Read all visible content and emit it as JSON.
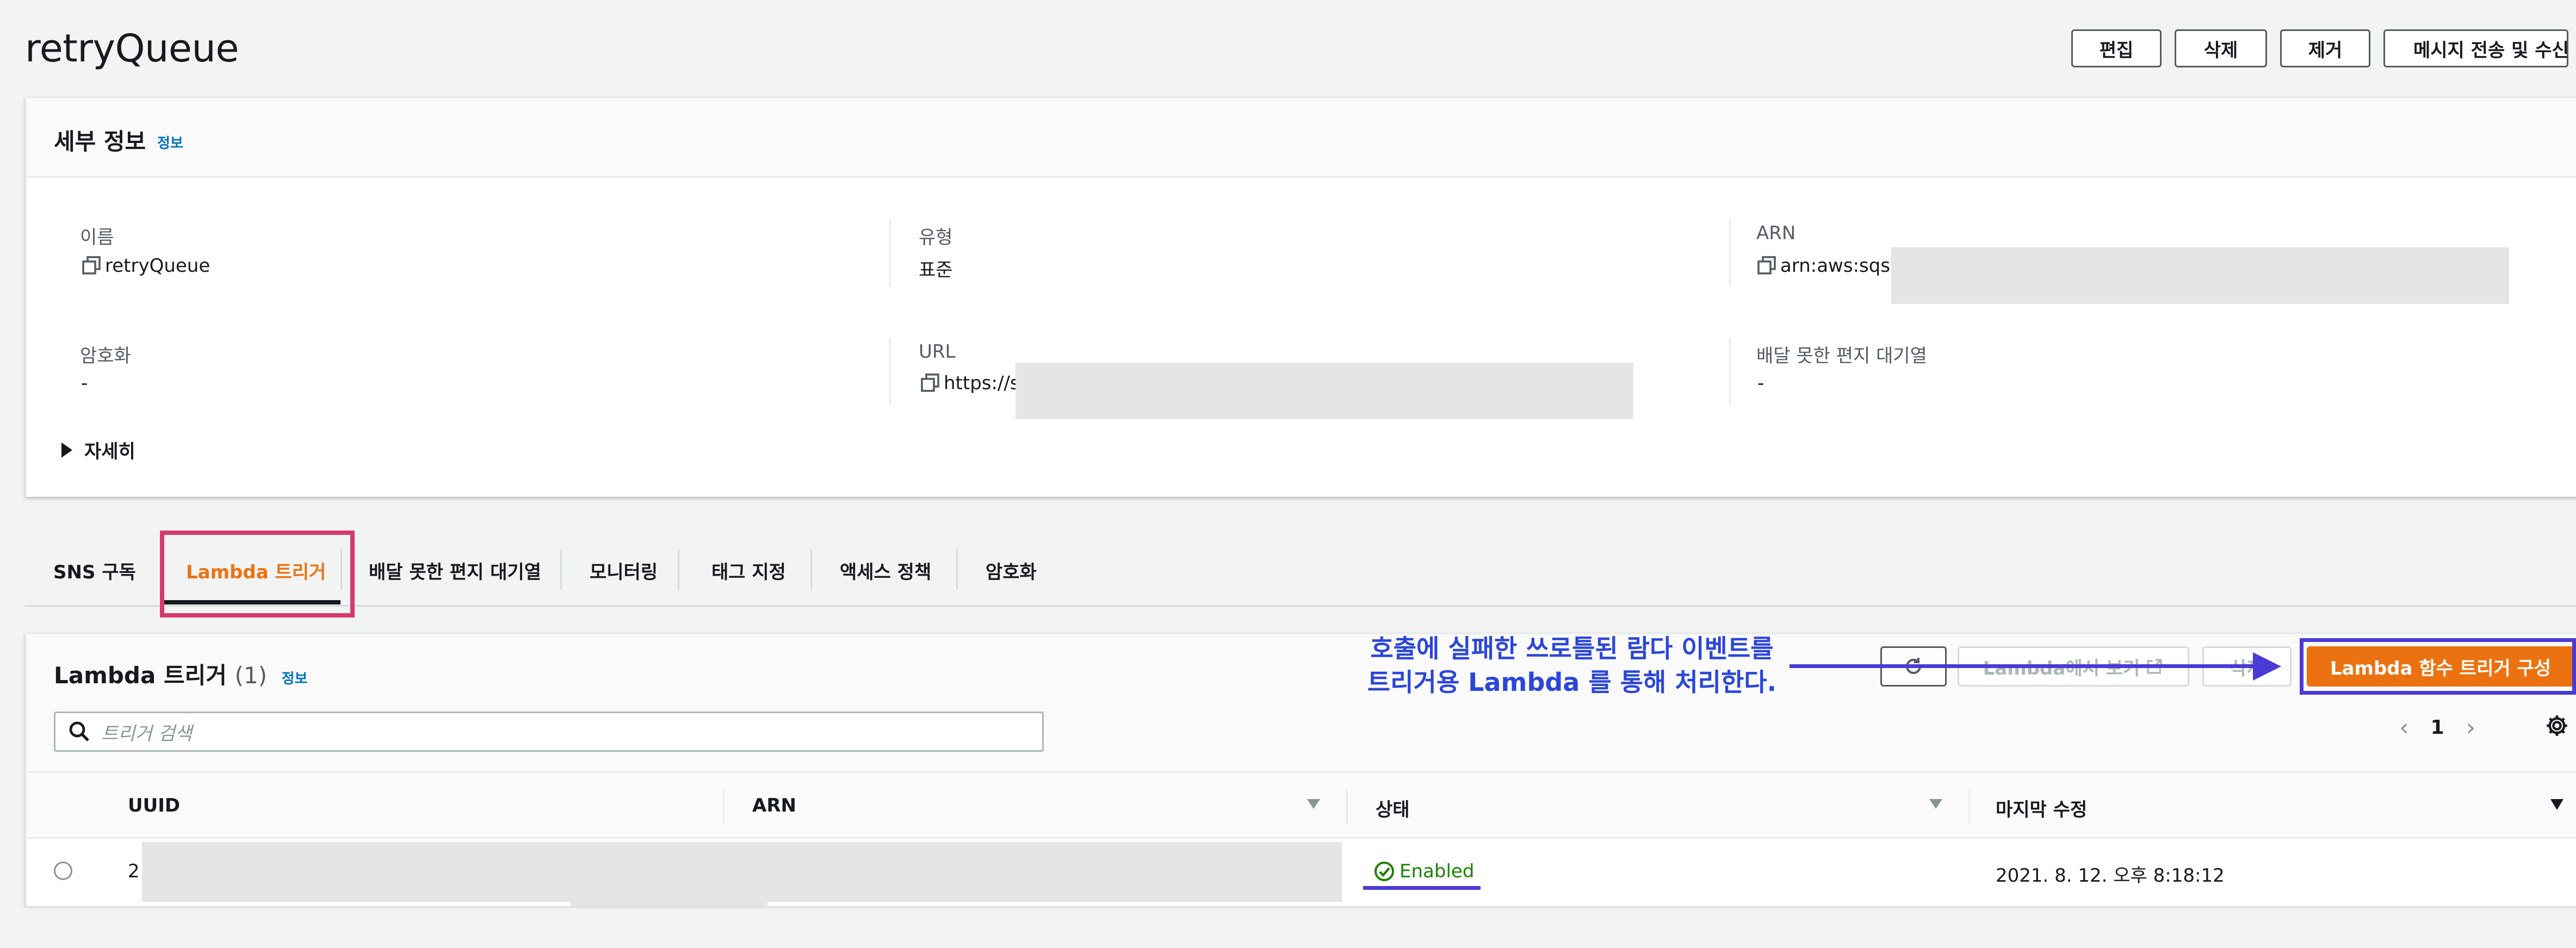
{
  "header": {
    "title": "retryQueue",
    "buttons": {
      "edit": "편집",
      "delete": "삭제",
      "purge": "제거",
      "send_receive": "메시지 전송 및 수신"
    }
  },
  "details": {
    "title": "세부 정보",
    "info": "정보",
    "fields": {
      "name": {
        "label": "이름",
        "value": "retryQueue"
      },
      "type": {
        "label": "유형",
        "value": "표준"
      },
      "arn": {
        "label": "ARN",
        "value": "arn:aws:sqs:a"
      },
      "encryption": {
        "label": "암호화",
        "value": "-"
      },
      "url": {
        "label": "URL",
        "value": "https://s"
      },
      "dlq": {
        "label": "배달 못한 편지 대기열",
        "value": "-"
      }
    },
    "more": "자세히"
  },
  "tabs": [
    {
      "label": "SNS 구독"
    },
    {
      "label": "Lambda 트리거"
    },
    {
      "label": "배달 못한 편지 대기열"
    },
    {
      "label": "모니터링"
    },
    {
      "label": "태그 지정"
    },
    {
      "label": "액세스 정책"
    },
    {
      "label": "암호화"
    }
  ],
  "active_tab": "Lambda 트리거",
  "lambda_panel": {
    "title": "Lambda 트리거",
    "count": "(1)",
    "info": "정보",
    "search_placeholder": "트리거 검색",
    "view_in_lambda": "Lambda에서 보기",
    "delete": "삭제",
    "configure": "Lambda 함수 트리거 구성",
    "page": "1",
    "columns": {
      "uuid": "UUID",
      "arn": "ARN",
      "status": "상태",
      "last_modified": "마지막 수정"
    },
    "rows": [
      {
        "uuid": "2",
        "status": "Enabled",
        "last_modified": "2021. 8. 12. 오후 8:18:12"
      }
    ]
  },
  "annotation": {
    "line1": "호출에 실패한 쓰로틀된 람다 이벤트를",
    "line2": "트리거용 Lambda 를 통해 처리한다."
  },
  "colors": {
    "accent": "#ec7211",
    "link": "#0073bb",
    "success": "#1d8102",
    "annotation": "#2b46d9",
    "highlight_box": "#d63a6b",
    "arrow": "#4a3ad6"
  }
}
